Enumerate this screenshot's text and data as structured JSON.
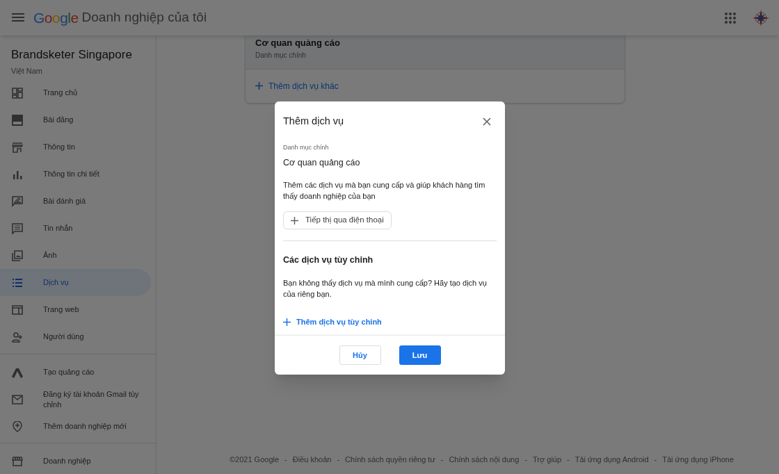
{
  "header": {
    "logo": "Google",
    "title": "Doanh nghiệp của tôi"
  },
  "business": {
    "name": "Brandsketer Singapore",
    "country": "Việt Nam"
  },
  "sidebar": {
    "groups": [
      {
        "items": [
          {
            "label": "Trang chủ",
            "selected": false
          },
          {
            "label": "Bài đăng",
            "selected": false
          },
          {
            "label": "Thông tin",
            "selected": false
          },
          {
            "label": "Thông tin chi tiết",
            "selected": false
          },
          {
            "label": "Bài đánh giá",
            "selected": false
          },
          {
            "label": "Tin nhắn",
            "selected": false
          },
          {
            "label": "Ảnh",
            "selected": false
          },
          {
            "label": "Dịch vụ",
            "selected": true
          },
          {
            "label": "Trang web",
            "selected": false
          },
          {
            "label": "Người dùng",
            "selected": false
          }
        ]
      },
      {
        "items": [
          {
            "label": "Tạo quảng cáo",
            "selected": false
          },
          {
            "label": "Đăng ký tài khoản Gmail tùy chỉnh",
            "selected": false
          },
          {
            "label": "Thêm doanh nghiệp mới",
            "selected": false
          }
        ]
      },
      {
        "items": [
          {
            "label": "Doanh nghiệp",
            "selected": false
          }
        ]
      }
    ]
  },
  "services_card": {
    "category": "Cơ quan quảng cáo",
    "category_label": "Danh mục chính",
    "add_link": "Thêm dịch vụ khác"
  },
  "footer": {
    "separator": "-",
    "links": [
      "©2021 Google",
      "Điều khoản",
      "Chính sách quyền riêng tư",
      "Chính sách nội dung",
      "Trợ giúp",
      "Tải ứng dụng Android",
      "Tải ứng dụng iPhone"
    ]
  },
  "dialog": {
    "title": "Thêm dịch vụ",
    "category_label": "Danh mục chính",
    "category": "Cơ quan quảng cáo",
    "description": "Thêm các dịch vụ mà bạn cung cấp và giúp khách hàng tìm thấy doanh nghiệp của bạn",
    "suggestions": [
      "Tiếp thị qua điện thoại"
    ],
    "custom_heading": "Các dịch vụ tùy chỉnh",
    "custom_description": "Bạn không thấy dịch vụ mà mình cung cấp? Hãy tạo dịch vụ của riêng bạn.",
    "custom_link": "Thêm dịch vụ tùy chỉnh",
    "buttons": [
      {
        "kind": "secondary",
        "label": "Hủy"
      },
      {
        "kind": "primary",
        "label": "Lưu"
      }
    ]
  }
}
